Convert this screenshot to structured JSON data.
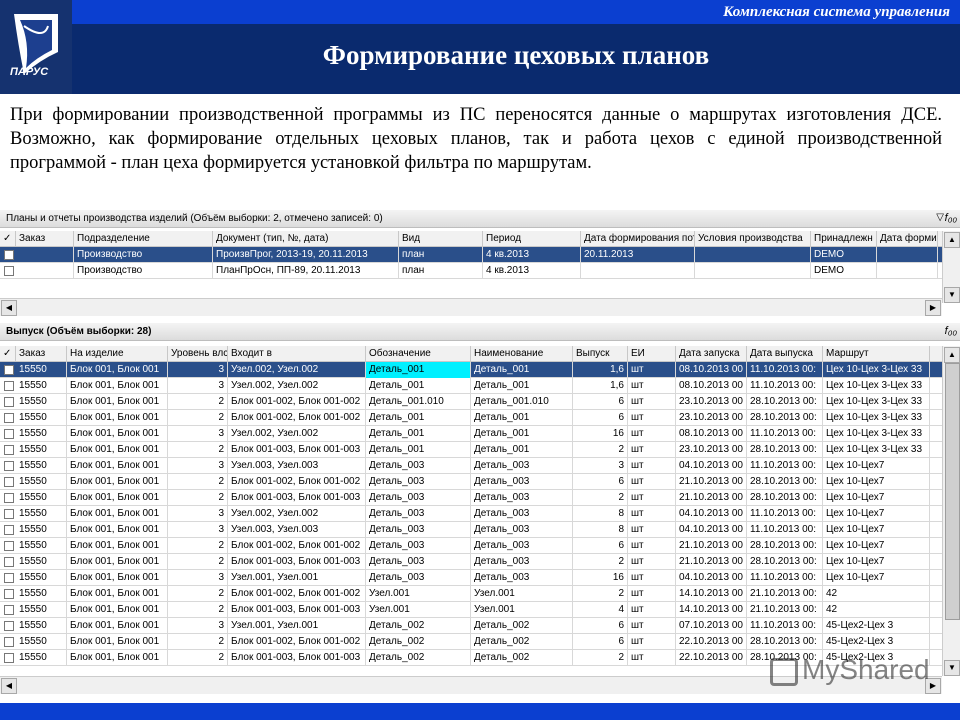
{
  "brand_text": "Комплексная система управления",
  "logo_text": "ПАРУС",
  "title": "Формирование цеховых планов",
  "description": "При формировании производственной программы из ПС переносятся данные о маршрутах изготовления ДСЕ. Возможно, как формирование отдельных цеховых планов, так и работа цехов с единой производственной программой - план цеха формируется установкой фильтра по маршрутам.",
  "plans": {
    "title": "Планы и отчеты производства изделий (Объём выборки: 2, отмечено записей: 0)",
    "columns": [
      "Заказ",
      "Подразделение",
      "Документ (тип, №, дата)",
      "Вид",
      "Период",
      "Дата формирования пот",
      "Условия производства",
      "Принадлежн",
      "Дата форми"
    ],
    "rows": [
      [
        "",
        "Производство",
        "ПроизвПрог, 2013-19, 20.11.2013",
        "план",
        "4 кв.2013",
        "20.11.2013",
        "",
        "DEMO",
        ""
      ],
      [
        "",
        "Производство",
        "ПланПрОсн, ПП-89, 20.11.2013",
        "план",
        "4 кв.2013",
        "",
        "",
        "DEMO",
        ""
      ]
    ]
  },
  "release": {
    "title": "Выпуск (Объём выборки: 28)",
    "columns": [
      "Заказ",
      "На изделие",
      "Уровень влс",
      "Входит в",
      "Обозначение",
      "Наименование",
      "Выпуск",
      "ЕИ",
      "Дата запуска",
      "Дата выпуска",
      "Маршрут"
    ],
    "rows": [
      [
        "15550",
        "Блок 001, Блок 001",
        "3",
        "Узел.002, Узел.002",
        "Деталь_001",
        "Деталь_001",
        "1,6",
        "шт",
        "08.10.2013 00",
        "11.10.2013 00:",
        "Цех 10-Цех 3-Цех 33"
      ],
      [
        "15550",
        "Блок 001, Блок 001",
        "3",
        "Узел.002, Узел.002",
        "Деталь_001",
        "Деталь_001",
        "1,6",
        "шт",
        "08.10.2013 00",
        "11.10.2013 00:",
        "Цех 10-Цех 3-Цех 33"
      ],
      [
        "15550",
        "Блок 001, Блок 001",
        "2",
        "Блок 001-002, Блок 001-002",
        "Деталь_001.010",
        "Деталь_001.010",
        "6",
        "шт",
        "23.10.2013 00",
        "28.10.2013 00:",
        "Цех 10-Цех 3-Цех 33"
      ],
      [
        "15550",
        "Блок 001, Блок 001",
        "2",
        "Блок 001-002, Блок 001-002",
        "Деталь_001",
        "Деталь_001",
        "6",
        "шт",
        "23.10.2013 00",
        "28.10.2013 00:",
        "Цех 10-Цех 3-Цех 33"
      ],
      [
        "15550",
        "Блок 001, Блок 001",
        "3",
        "Узел.002, Узел.002",
        "Деталь_001",
        "Деталь_001",
        "16",
        "шт",
        "08.10.2013 00",
        "11.10.2013 00:",
        "Цех 10-Цех 3-Цех 33"
      ],
      [
        "15550",
        "Блок 001, Блок 001",
        "2",
        "Блок 001-003, Блок 001-003",
        "Деталь_001",
        "Деталь_001",
        "2",
        "шт",
        "23.10.2013 00",
        "28.10.2013 00:",
        "Цех 10-Цех 3-Цех 33"
      ],
      [
        "15550",
        "Блок 001, Блок 001",
        "3",
        "Узел.003, Узел.003",
        "Деталь_003",
        "Деталь_003",
        "3",
        "шт",
        "04.10.2013 00",
        "11.10.2013 00:",
        "Цех 10-Цех7"
      ],
      [
        "15550",
        "Блок 001, Блок 001",
        "2",
        "Блок 001-002, Блок 001-002",
        "Деталь_003",
        "Деталь_003",
        "6",
        "шт",
        "21.10.2013 00",
        "28.10.2013 00:",
        "Цех 10-Цех7"
      ],
      [
        "15550",
        "Блок 001, Блок 001",
        "2",
        "Блок 001-003, Блок 001-003",
        "Деталь_003",
        "Деталь_003",
        "2",
        "шт",
        "21.10.2013 00",
        "28.10.2013 00:",
        "Цех 10-Цех7"
      ],
      [
        "15550",
        "Блок 001, Блок 001",
        "3",
        "Узел.002, Узел.002",
        "Деталь_003",
        "Деталь_003",
        "8",
        "шт",
        "04.10.2013 00",
        "11.10.2013 00:",
        "Цех 10-Цех7"
      ],
      [
        "15550",
        "Блок 001, Блок 001",
        "3",
        "Узел.003, Узел.003",
        "Деталь_003",
        "Деталь_003",
        "8",
        "шт",
        "04.10.2013 00",
        "11.10.2013 00:",
        "Цех 10-Цех7"
      ],
      [
        "15550",
        "Блок 001, Блок 001",
        "2",
        "Блок 001-002, Блок 001-002",
        "Деталь_003",
        "Деталь_003",
        "6",
        "шт",
        "21.10.2013 00",
        "28.10.2013 00:",
        "Цех 10-Цех7"
      ],
      [
        "15550",
        "Блок 001, Блок 001",
        "2",
        "Блок 001-003, Блок 001-003",
        "Деталь_003",
        "Деталь_003",
        "2",
        "шт",
        "21.10.2013 00",
        "28.10.2013 00:",
        "Цех 10-Цех7"
      ],
      [
        "15550",
        "Блок 001, Блок 001",
        "3",
        "Узел.001, Узел.001",
        "Деталь_003",
        "Деталь_003",
        "16",
        "шт",
        "04.10.2013 00",
        "11.10.2013 00:",
        "Цех 10-Цех7"
      ],
      [
        "15550",
        "Блок 001, Блок 001",
        "2",
        "Блок 001-002, Блок 001-002",
        "Узел.001",
        "Узел.001",
        "2",
        "шт",
        "14.10.2013 00",
        "21.10.2013 00:",
        "42"
      ],
      [
        "15550",
        "Блок 001, Блок 001",
        "2",
        "Блок 001-003, Блок 001-003",
        "Узел.001",
        "Узел.001",
        "4",
        "шт",
        "14.10.2013 00",
        "21.10.2013 00:",
        "42"
      ],
      [
        "15550",
        "Блок 001, Блок 001",
        "3",
        "Узел.001, Узел.001",
        "Деталь_002",
        "Деталь_002",
        "6",
        "шт",
        "07.10.2013 00",
        "11.10.2013 00:",
        "45-Цех2-Цех 3"
      ],
      [
        "15550",
        "Блок 001, Блок 001",
        "2",
        "Блок 001-002, Блок 001-002",
        "Деталь_002",
        "Деталь_002",
        "6",
        "шт",
        "22.10.2013 00",
        "28.10.2013 00:",
        "45-Цех2-Цех 3"
      ],
      [
        "15550",
        "Блок 001, Блок 001",
        "2",
        "Блок 001-003, Блок 001-003",
        "Деталь_002",
        "Деталь_002",
        "2",
        "шт",
        "22.10.2013 00",
        "28.10.2013 00:",
        "45-Цех2-Цех 3"
      ]
    ]
  },
  "watermark": "MyShared"
}
